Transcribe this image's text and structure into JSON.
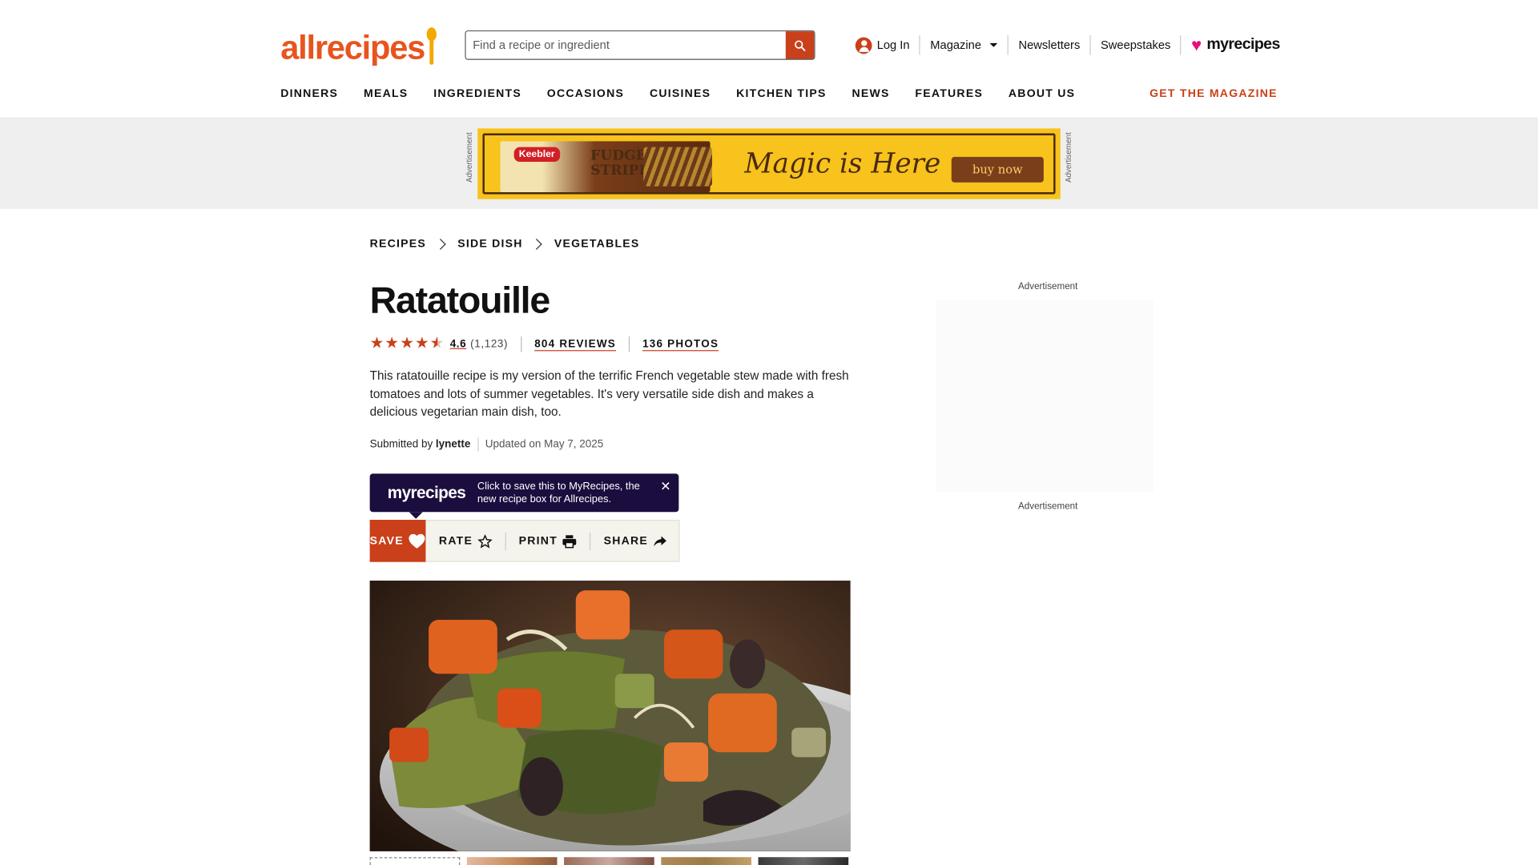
{
  "header": {
    "logo_text": "allrecipes",
    "search_placeholder": "Find a recipe or ingredient",
    "login_label": "Log In",
    "magazine_label": "Magazine",
    "newsletters_label": "Newsletters",
    "sweepstakes_label": "Sweepstakes",
    "myrecipes_label": "myrecipes",
    "brand_color": "#e8541e",
    "accent_color": "#c9401a"
  },
  "mainnav": {
    "items": [
      "DINNERS",
      "MEALS",
      "INGREDIENTS",
      "OCCASIONS",
      "CUISINES",
      "KITCHEN TIPS",
      "NEWS",
      "FEATURES",
      "ABOUT US"
    ],
    "cta": "GET THE MAGAZINE"
  },
  "ad": {
    "label": "Advertisement",
    "brand": "Keebler",
    "product_line1": "FUDGE",
    "product_line2": "STRIPES",
    "headline": "Magic is Here",
    "button": "buy now"
  },
  "breadcrumb": [
    "RECIPES",
    "SIDE DISH",
    "VEGETABLES"
  ],
  "recipe": {
    "title": "Ratatouille",
    "rating": "4.6",
    "rating_value": 4.6,
    "rating_count": "(1,123)",
    "reviews": "804 REVIEWS",
    "photos": "136 PHOTOS",
    "description": "This ratatouille recipe is my version of the terrific French vegetable stew made with fresh tomatoes and lots of summer vegetables. It's very versatile side dish and makes a delicious vegetarian main dish, too.",
    "submitted_by_label": "Submitted by",
    "author": "lynette",
    "updated": "Updated on May 7, 2025"
  },
  "tooltip": {
    "logo_my": "my",
    "logo_recipes": "recipes",
    "text": "Click to save this to MyRecipes, the new recipe box for Allrecipes.",
    "close": "✕"
  },
  "actions": {
    "save": "SAVE",
    "rate": "RATE",
    "print": "PRINT",
    "share": "SHARE"
  },
  "sidebar": {
    "ad_label_top": "Advertisement",
    "ad_label_bottom": "Advertisement"
  }
}
